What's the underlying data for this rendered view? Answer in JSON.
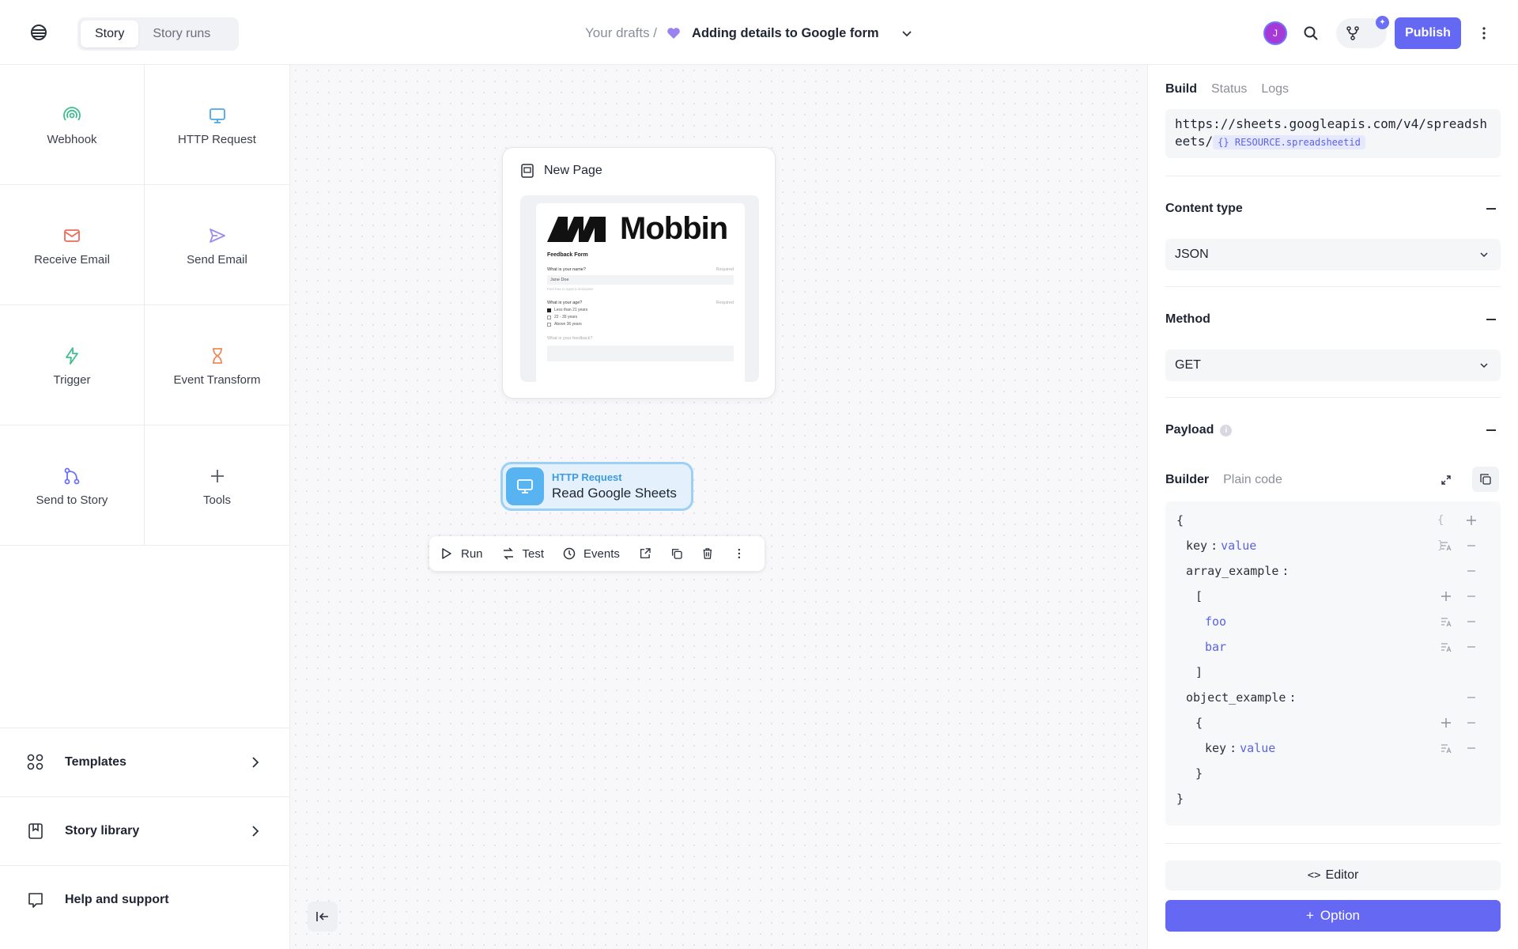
{
  "header": {
    "tabs": [
      "Story",
      "Story runs"
    ],
    "active_tab": "Story",
    "breadcrumb_root": "Your drafts /",
    "story_title": "Adding details to Google form",
    "avatar_initial": "J",
    "publish_label": "Publish",
    "accent_color": "#6468f2"
  },
  "sidebar": {
    "tiles": [
      {
        "label": "Webhook",
        "icon": "webhook-icon",
        "color": "#3fbf8f"
      },
      {
        "label": "HTTP Request",
        "icon": "monitor-icon",
        "color": "#4aa8e8"
      },
      {
        "label": "Receive Email",
        "icon": "envelope-icon",
        "color": "#ee6a5a"
      },
      {
        "label": "Send Email",
        "icon": "send-icon",
        "color": "#9a8df0"
      },
      {
        "label": "Trigger",
        "icon": "lightning-icon",
        "color": "#3fbf8f"
      },
      {
        "label": "Event Transform",
        "icon": "hourglass-icon",
        "color": "#ee8a5a"
      },
      {
        "label": "Send to Story",
        "icon": "branch-icon",
        "color": "#6b6ff7"
      },
      {
        "label": "Tools",
        "icon": "plus-icon",
        "color": "#555b68"
      }
    ],
    "nav": [
      {
        "label": "Templates",
        "icon": "grid-icon"
      },
      {
        "label": "Story library",
        "icon": "book-icon"
      },
      {
        "label": "Help and support",
        "icon": "chat-icon"
      }
    ]
  },
  "canvas": {
    "page_card": {
      "title": "New Page",
      "preview": {
        "brand": "Mobbin",
        "form_title": "Feedback Form",
        "q1": "What is your name?",
        "q1_required": "Required",
        "q1_value": "Jane Doe",
        "q1_hint": "Feel free to input a nickname",
        "q2": "What is your age?",
        "q2_required": "Required",
        "q2_options": [
          "Less than 21 years",
          "22 - 35 years",
          "Above 36 years"
        ],
        "q3": "What is your feedback?"
      }
    },
    "node": {
      "type": "HTTP Request",
      "name": "Read Google Sheets"
    },
    "toolbar": {
      "run": "Run",
      "test": "Test",
      "events": "Events"
    }
  },
  "panel": {
    "tabs": [
      "Build",
      "Status",
      "Logs"
    ],
    "active_tab": "Build",
    "url_text": "https://sheets.googleapis.com/v4/spreadsheets/",
    "url_tag": "{} RESOURCE.spreadsheetid",
    "content_type_label": "Content type",
    "content_type_value": "JSON",
    "method_label": "Method",
    "method_value": "GET",
    "payload_label": "Payload",
    "builder_tabs": [
      "Builder",
      "Plain code"
    ],
    "active_builder_tab": "Builder",
    "code": {
      "open_brace": "{",
      "key1": "key",
      "val1": "value",
      "key2": "array_example",
      "arr_open": "[",
      "item1": "foo",
      "item2": "bar",
      "arr_close": "]",
      "key3": "object_example",
      "obj_open": "{",
      "key4": "key",
      "val4": "value",
      "obj_close": "}",
      "close_brace": "}",
      "colon": ":"
    },
    "editor_label": "Editor",
    "option_label": "Option"
  }
}
